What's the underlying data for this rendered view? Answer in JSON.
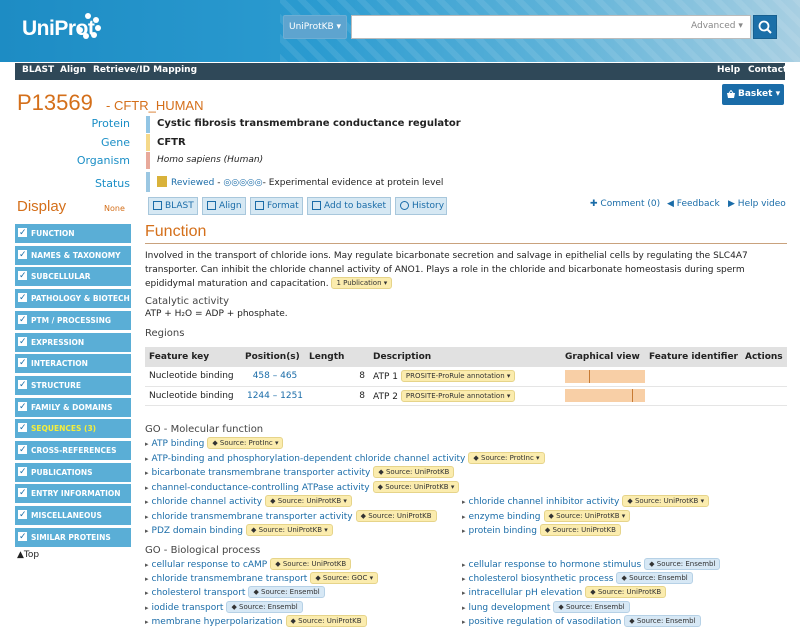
{
  "header": {
    "logo_text": "UniProt",
    "db_select": "UniProtKB",
    "search_placeholder": "",
    "advanced_label": "Advanced"
  },
  "nav": {
    "items": [
      "BLAST",
      "Align",
      "Retrieve/ID Mapping"
    ],
    "right": [
      "Help",
      "Contact"
    ]
  },
  "entry": {
    "accession": "P13569",
    "name": "- CFTR_HUMAN",
    "basket_label": "Basket"
  },
  "summary": [
    {
      "label": "Protein",
      "value": "Cystic fibrosis transmembrane conductance regulator"
    },
    {
      "label": "Gene",
      "value": "CFTR"
    },
    {
      "label": "Organism",
      "value": "Homo sapiens (Human)"
    },
    {
      "label": "Status",
      "value": "Reviewed",
      "stars": "◎◎◎◎◎",
      "note": "- Experimental evidence at protein level"
    }
  ],
  "display": {
    "title": "Display",
    "none_label": "None",
    "items": [
      "FUNCTION",
      "NAMES & TAXONOMY",
      "SUBCELLULAR LOCATION",
      "PATHOLOGY & BIOTECH",
      "PTM / PROCESSING",
      "EXPRESSION",
      "INTERACTION",
      "STRUCTURE",
      "FAMILY & DOMAINS",
      "SEQUENCES (3)",
      "CROSS-REFERENCES",
      "PUBLICATIONS",
      "ENTRY INFORMATION",
      "MISCELLANEOUS",
      "SIMILAR PROTEINS"
    ],
    "top_label": "Top"
  },
  "toolbar": {
    "buttons": [
      "BLAST",
      "Align",
      "Format",
      "Add to basket",
      "History"
    ],
    "comment": "Comment (0)",
    "feedback": "Feedback",
    "help_video": "Help video"
  },
  "function": {
    "title": "Function",
    "text": "Involved in the transport of chloride ions. May regulate bicarbonate secretion and salvage in epithelial cells by regulating the SLC4A7 transporter. Can inhibit the chloride channel activity of ANO1. Plays a role in the chloride and bicarbonate homeostasis during sperm epididymal maturation and capacitation.",
    "publication_pill": "1 Publication",
    "catalytic_title": "Catalytic activity",
    "catalytic_text": "ATP + H₂O = ADP + phosphate.",
    "regions_title": "Regions"
  },
  "regions_table": {
    "headers": [
      "Feature key",
      "Position(s)",
      "Length",
      "Description",
      "Graphical view",
      "Feature identifier",
      "Actions"
    ],
    "rows": [
      {
        "key": "Nucleotide binding",
        "pos": "458 – 465",
        "length": "8",
        "desc": "ATP 1",
        "ann": "PROSITE-ProRule annotation",
        "mark_fraction": 0.3
      },
      {
        "key": "Nucleotide binding",
        "pos": "1244 – 1251",
        "length": "8",
        "desc": "ATP 2",
        "ann": "PROSITE-ProRule annotation",
        "mark_fraction": 0.84
      }
    ]
  },
  "go_molecular": {
    "title": "GO - Molecular function",
    "left": [
      {
        "term": "ATP binding",
        "src": "Source: ProtInc",
        "c": "y",
        "dd": true
      },
      {
        "term": "ATP-binding and phosphorylation-dependent chloride channel activity",
        "src": "Source: ProtInc",
        "c": "y",
        "dd": true
      },
      {
        "term": "bicarbonate transmembrane transporter activity",
        "src": "Source: UniProtKB",
        "c": "y",
        "dd": false
      },
      {
        "term": "channel-conductance-controlling ATPase activity",
        "src": "Source: UniProtKB",
        "c": "y",
        "dd": true
      },
      {
        "term": "chloride channel activity",
        "src": "Source: UniProtKB",
        "c": "y",
        "dd": true
      },
      {
        "term": "chloride transmembrane transporter activity",
        "src": "Source: UniProtKB",
        "c": "y",
        "dd": false
      },
      {
        "term": "PDZ domain binding",
        "src": "Source: UniProtKB",
        "c": "y",
        "dd": true
      }
    ],
    "right": [
      {
        "term": "chloride channel inhibitor activity",
        "src": "Source: UniProtKB",
        "c": "y",
        "dd": true
      },
      {
        "term": "enzyme binding",
        "src": "Source: UniProtKB",
        "c": "y",
        "dd": true
      },
      {
        "term": "protein binding",
        "src": "Source: UniProtKB",
        "c": "y",
        "dd": false
      }
    ]
  },
  "go_biological": {
    "title": "GO - Biological process",
    "left": [
      {
        "term": "cellular response to cAMP",
        "src": "Source: UniProtKB",
        "c": "y",
        "dd": false
      },
      {
        "term": "chloride transmembrane transport",
        "src": "Source: GOC",
        "c": "y",
        "dd": true
      },
      {
        "term": "cholesterol transport",
        "src": "Source: Ensembl",
        "c": "b",
        "dd": false
      },
      {
        "term": "iodide transport",
        "src": "Source: Ensembl",
        "c": "b",
        "dd": false
      },
      {
        "term": "membrane hyperpolarization",
        "src": "Source: UniProtKB",
        "c": "y",
        "dd": false
      }
    ],
    "right": [
      {
        "term": "cellular response to hormone stimulus",
        "src": "Source: Ensembl",
        "c": "b",
        "dd": false
      },
      {
        "term": "cholesterol biosynthetic process",
        "src": "Source: Ensembl",
        "c": "b",
        "dd": false
      },
      {
        "term": "intracellular pH elevation",
        "src": "Source: UniProtKB",
        "c": "y",
        "dd": false
      },
      {
        "term": "lung development",
        "src": "Source: Ensembl",
        "c": "b",
        "dd": false
      },
      {
        "term": "positive regulation of vasodilation",
        "src": "Source: Ensembl",
        "c": "b",
        "dd": false
      }
    ]
  }
}
